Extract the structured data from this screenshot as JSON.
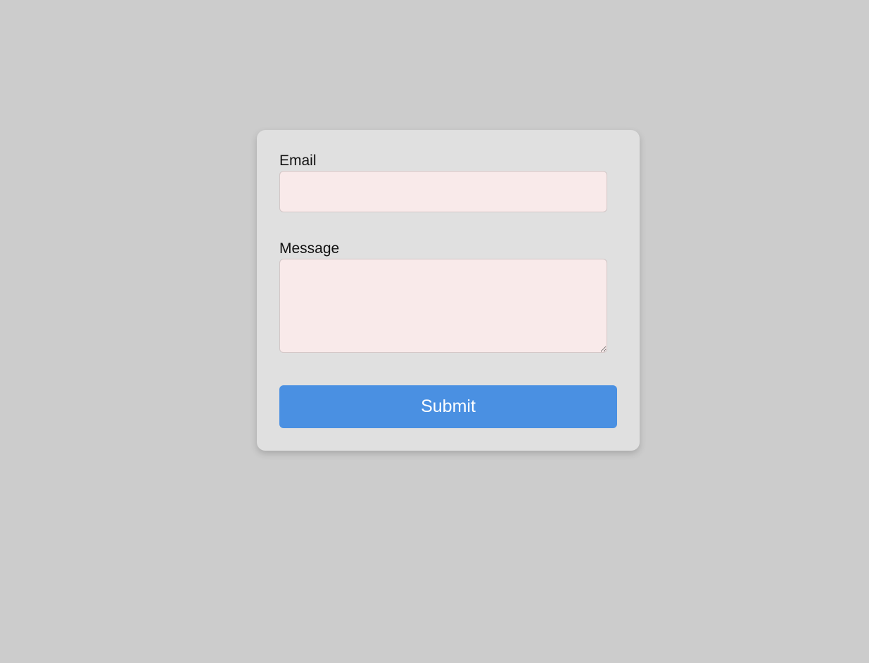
{
  "form": {
    "email_label": "Email",
    "email_value": "",
    "message_label": "Message",
    "message_value": "",
    "submit_label": "Submit"
  },
  "colors": {
    "page_background": "#cccccc",
    "card_background": "#e0e0e0",
    "field_background": "#f9eaea",
    "submit_background": "#4a90e2",
    "submit_text": "#ffffff"
  }
}
